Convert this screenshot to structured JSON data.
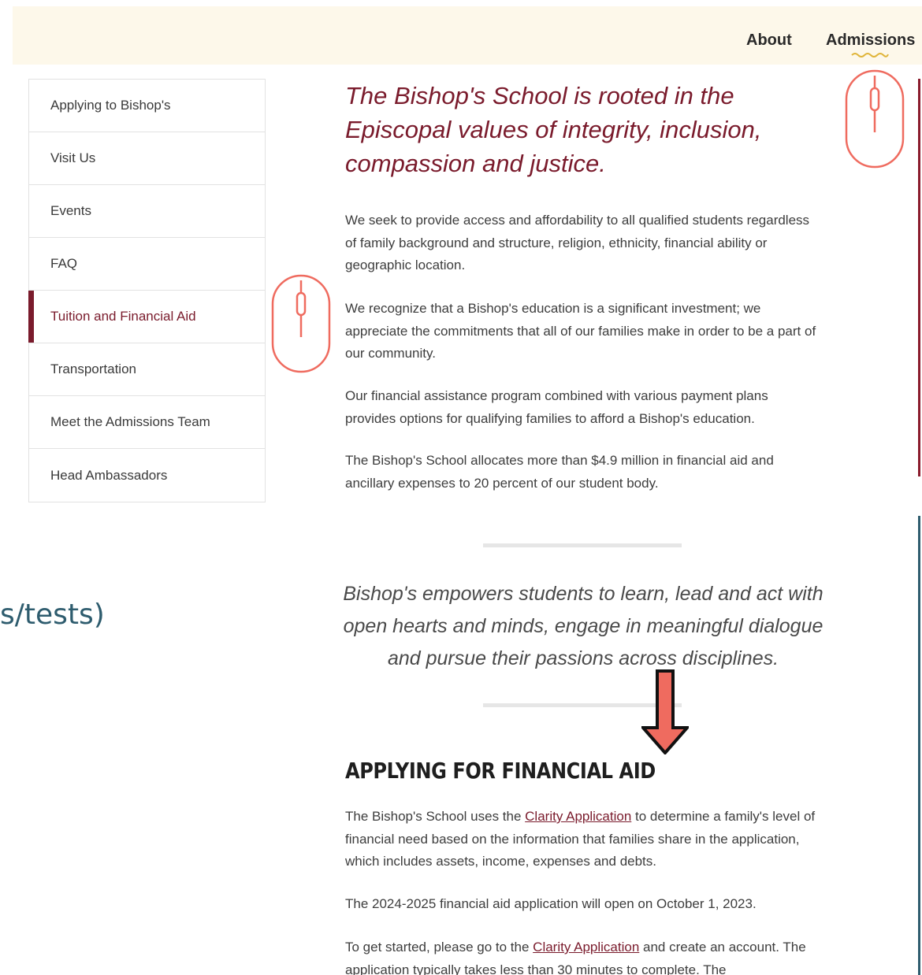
{
  "topnav": {
    "items": [
      {
        "label": "About"
      },
      {
        "label": "Admissions"
      }
    ]
  },
  "sidebar": {
    "items": [
      {
        "label": "Applying to Bishop's"
      },
      {
        "label": "Visit Us"
      },
      {
        "label": "Events"
      },
      {
        "label": "FAQ"
      },
      {
        "label": "Tuition and Financial Aid",
        "active": true
      },
      {
        "label": "Transportation"
      },
      {
        "label": "Meet the Admissions Team"
      },
      {
        "label": "Head Ambassadors"
      }
    ]
  },
  "main": {
    "intro_quote": "The Bishop's School is rooted in the Episcopal values of integrity, inclusion, compassion and justice.",
    "paragraphs": [
      "We seek to provide access and affordability to all qualified students regardless of family background and structure, religion, ethnicity, financial ability or geographic location.",
      "We recognize that a Bishop's education is a significant investment; we appreciate the commitments that all of our families make in order to be a part of our community.",
      "Our financial assistance program combined with various payment plans provides options for qualifying families to afford a Bishop's education.",
      "The Bishop's School allocates more than $4.9 million in financial aid and ancillary expenses to 20 percent of our student body."
    ],
    "mid_quote": "Bishop's empowers students to learn, lead and act with open hearts and minds, engage in meaningful dialogue and pursue their passions across disciplines.",
    "section_heading": "APPLYING FOR FINANCIAL AID",
    "fa_para1_before": "The Bishop's School uses the ",
    "fa_para1_link": "Clarity Application",
    "fa_para1_after": " to determine a family's level of financial need based on the information that families share in the application, which includes assets, income, expenses and debts.",
    "fa_para2": "The 2024-2025 financial aid application will open on October 1, 2023.",
    "fa_para3_before": "To get started, please go to the ",
    "fa_para3_link": "Clarity Application",
    "fa_para3_after": " and create an account. The application typically takes less than 30 minutes to complete. The"
  },
  "overlay": {
    "partial_text": "s/tests)"
  },
  "colors": {
    "topbar_bg": "#fdf8ea",
    "accent_maroon": "#7a1b2c",
    "teal": "#2e5c6e",
    "mouse_icon": "#ef6b5f",
    "arrow_fill": "#ef6b5f"
  },
  "icons": {
    "scroll_mouse": "mouse-scroll-icon",
    "arrow": "arrow-down-icon",
    "squiggle": "squiggle-underline-icon"
  }
}
